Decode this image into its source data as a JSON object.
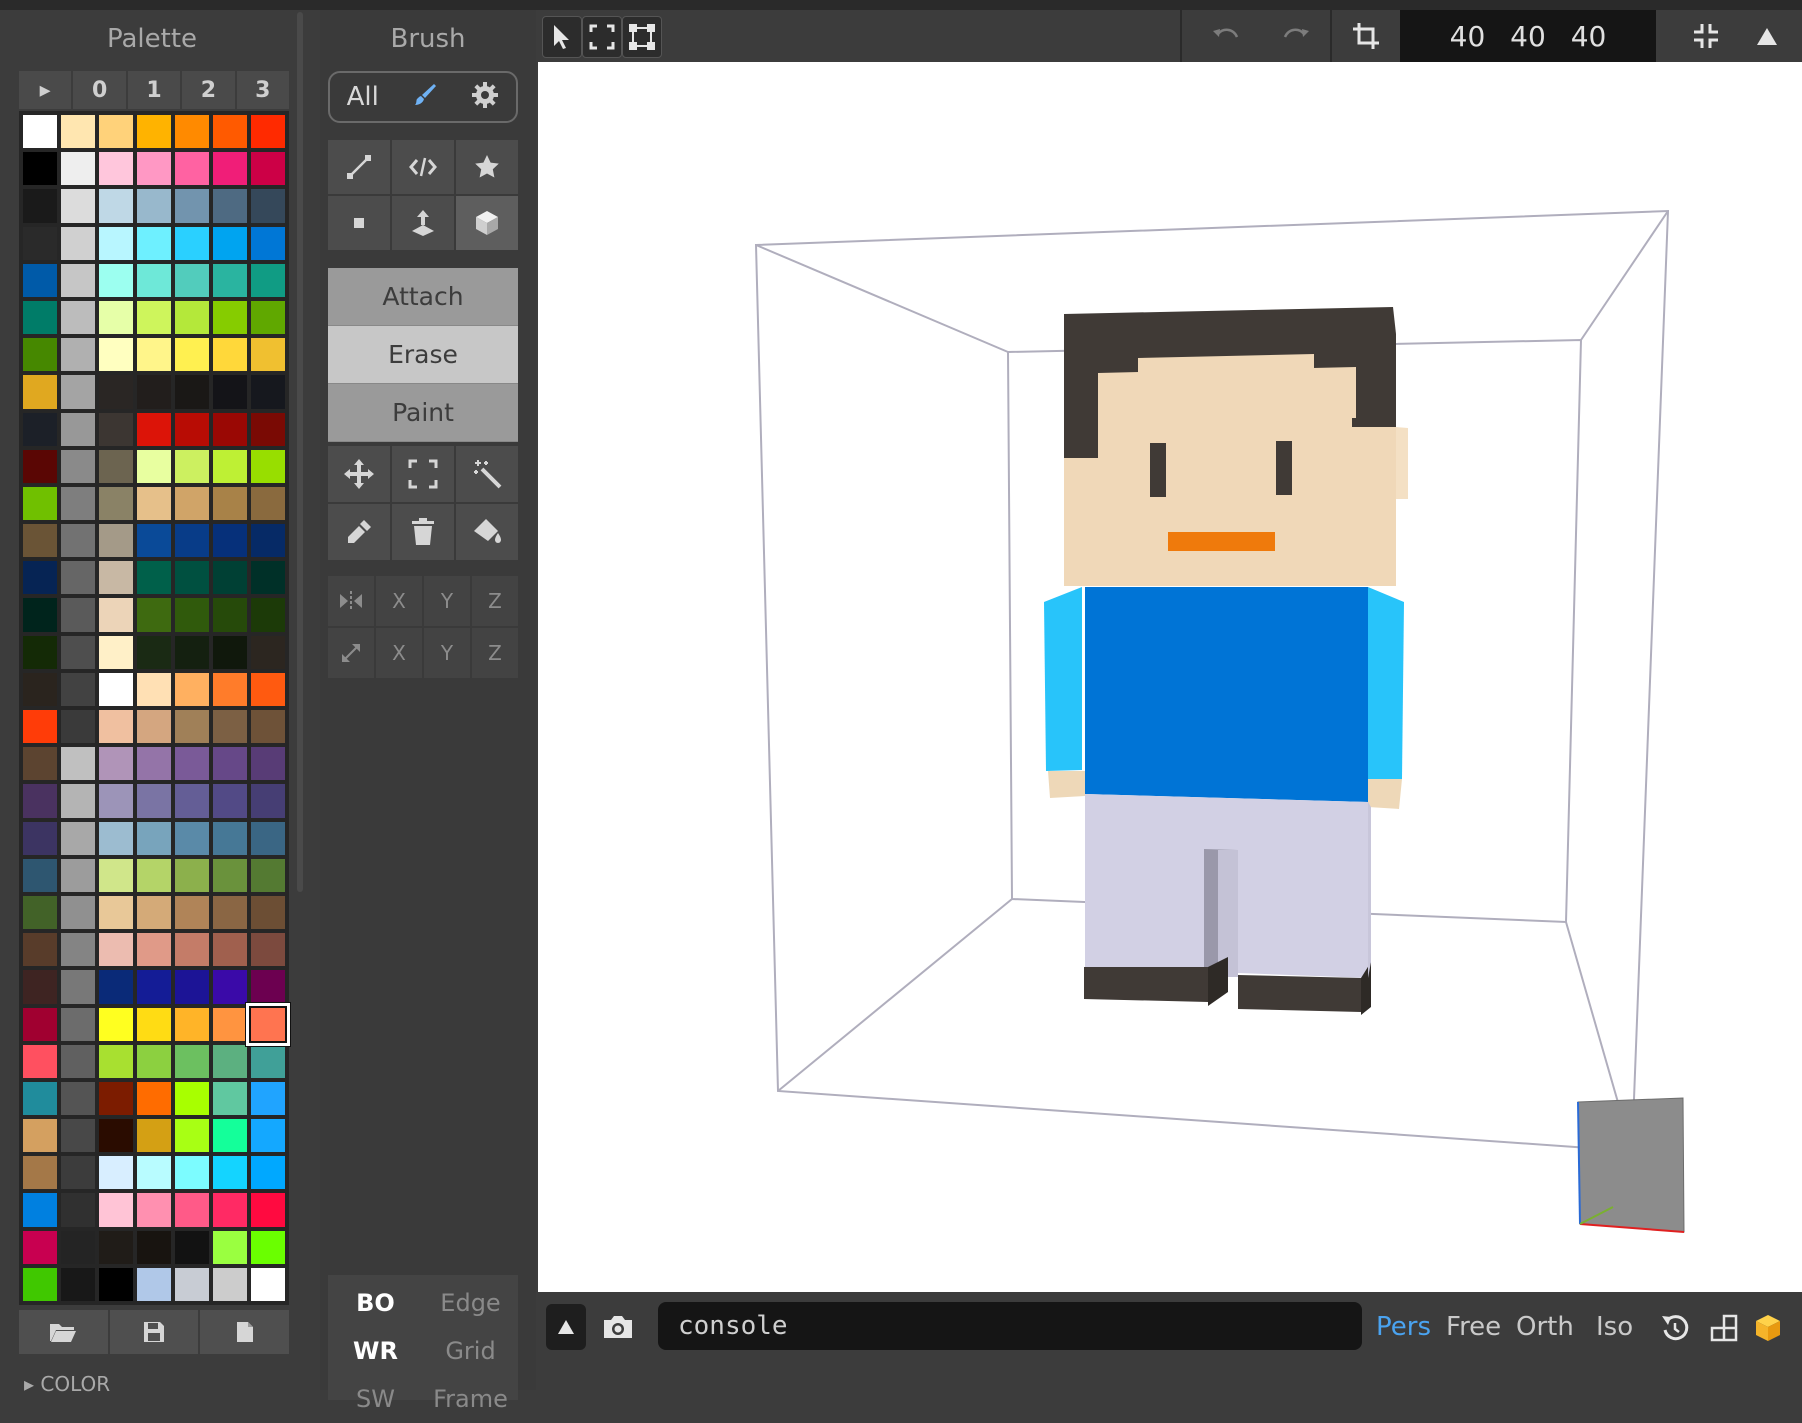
{
  "palette": {
    "title": "Palette",
    "tabs": [
      "▸",
      "0",
      "1",
      "2",
      "3"
    ],
    "color_toggle": "▸ COLOR",
    "actions": [
      "folder-open-icon",
      "save-icon",
      "new-file-icon"
    ],
    "selected_index": 174,
    "colors": [
      "#ffffff",
      "#ffe6b0",
      "#ffd27a",
      "#ffb300",
      "#ff8a00",
      "#ff5a00",
      "#ff2a00",
      "#000000",
      "#eeeeee",
      "#ffc6dc",
      "#ff98c4",
      "#ff62a2",
      "#f01e78",
      "#cc0046",
      "#1a1a1a",
      "#dcdcdc",
      "#bfd8e6",
      "#98b8cc",
      "#7294ae",
      "#4e6a82",
      "#35485a",
      "#2a2a2a",
      "#d0d0d0",
      "#b8f6ff",
      "#6ef0ff",
      "#2ad0ff",
      "#00a4f0",
      "#0077d6",
      "#005aa8",
      "#c6c6c6",
      "#9cfff0",
      "#6ee8d8",
      "#52ccbc",
      "#2ab4a0",
      "#109c84",
      "#007c68",
      "#bcbcbc",
      "#e6ffa8",
      "#cef55c",
      "#b4e83a",
      "#86cc00",
      "#60a800",
      "#468800",
      "#b0b0b0",
      "#ffffc0",
      "#fff58a",
      "#fff050",
      "#ffd83a",
      "#f0c030",
      "#e0a820",
      "#a4a4a4",
      "#2a2624",
      "#221e1c",
      "#1a1816",
      "#141418",
      "#16181e",
      "#1c2028",
      "#989898",
      "#3c3632",
      "#dc1408",
      "#b80c04",
      "#9a0804",
      "#7a0a04",
      "#5a0604",
      "#8a8a8a",
      "#6c6450",
      "#e8ffa0",
      "#ccf060",
      "#bef034",
      "#98de00",
      "#70c000",
      "#7e7e7e",
      "#8a8266",
      "#e6c08a",
      "#d0a468",
      "#a88248",
      "#8a6a3e",
      "#6a5436",
      "#727272",
      "#a49a88",
      "#0a4a98",
      "#083c88",
      "#06307a",
      "#062a66",
      "#062454",
      "#666666",
      "#c8b8a4",
      "#00604a",
      "#005040",
      "#004034",
      "#003028",
      "#00241c",
      "#5a5a5a",
      "#ecd4b8",
      "#3e6a10",
      "#305a0c",
      "#264a0a",
      "#1c3a08",
      "#142a06",
      "#4e4e4e",
      "#fff0c8",
      "#1a2a14",
      "#142010",
      "#10180c",
      "#2c2620",
      "#2a241e",
      "#424242",
      "#ffffff",
      "#ffe0b4",
      "#ffb060",
      "#ff7c2a",
      "#ff5a10",
      "#ff3c08",
      "#3a3a3a",
      "#f0c0a0",
      "#d4a680",
      "#a08058",
      "#7c6044",
      "#6e5238",
      "#5c4430",
      "#c0c0c0",
      "#b094b8",
      "#9474a8",
      "#7a5a98",
      "#664888",
      "#583c76",
      "#4a3260",
      "#b4b4b4",
      "#9c94b8",
      "#7a74a4",
      "#645e96",
      "#524a86",
      "#463e74",
      "#3c3462",
      "#a8a8a8",
      "#9cbcd0",
      "#78a4bc",
      "#5a8aa8",
      "#467896",
      "#3a6684",
      "#2e5670",
      "#9c9c9c",
      "#d0e68a",
      "#b4d468",
      "#8cb04c",
      "#6a923c",
      "#547a32",
      "#426228",
      "#909090",
      "#e8c898",
      "#d4aa78",
      "#b08458",
      "#8a6644",
      "#6c4e34",
      "#583c2a",
      "#848484",
      "#ecbcb0",
      "#e09a88",
      "#c47c68",
      "#a0604e",
      "#7c4a3e",
      "#3e2422",
      "#787878",
      "#0a2a78",
      "#141c96",
      "#1c1496",
      "#3a0aa8",
      "#6c0050",
      "#a00030",
      "#6c6c6c",
      "#ffff20",
      "#ffdc14",
      "#ffb428",
      "#ff9440",
      "#ff7450",
      "#ff5060",
      "#606060",
      "#a8e030",
      "#8cd040",
      "#6cc060",
      "#5cb080",
      "#40a098",
      "#208c9c",
      "#545454",
      "#7c1c00",
      "#ff6c00",
      "#a8ff00",
      "#60c8a0",
      "#20a4ff",
      "#d4a060",
      "#484848",
      "#2a0c00",
      "#d4a014",
      "#a8ff14",
      "#14ff9a",
      "#14a8ff",
      "#a47848",
      "#3c3c3c",
      "#d8eeff",
      "#b8fcff",
      "#7cfcff",
      "#14d4ff",
      "#00a8ff",
      "#0080e0",
      "#303030",
      "#ffc4d6",
      "#ff90b0",
      "#ff5a88",
      "#ff2a64",
      "#ff0a40",
      "#c80050",
      "#242424",
      "#201c18",
      "#181410",
      "#121212",
      "#9aff40",
      "#6aff00",
      "#40c800",
      "#181818",
      "#000000",
      "#b0c8e8",
      "#c8ccd4",
      "#cccccc",
      "#ffffff",
      "#285846"
    ]
  },
  "brush": {
    "title": "Brush",
    "filter_label": "All",
    "modes": [
      "Attach",
      "Erase",
      "Paint"
    ],
    "active_mode": "Erase",
    "axis_rows": [
      [
        "X",
        "Y",
        "Z"
      ],
      [
        "X",
        "Y",
        "Z"
      ]
    ]
  },
  "render": {
    "items": [
      {
        "label": "BO",
        "state": "on"
      },
      {
        "label": "Edge",
        "state": "off"
      },
      {
        "label": "WR",
        "state": "on"
      },
      {
        "label": "Grid",
        "state": "off"
      },
      {
        "label": "SW",
        "state": "off"
      },
      {
        "label": "Frame",
        "state": "off"
      }
    ]
  },
  "toolbar": {
    "dimensions": "40 40 40"
  },
  "console": {
    "text": "console"
  },
  "camera_modes": [
    "Pers",
    "Free",
    "Orth",
    "Iso"
  ],
  "active_camera": "Pers",
  "colors": {
    "accent": "#4aa3f0",
    "panel": "#3c3c3c",
    "skin": "#f0d8b8",
    "hair": "#403a36",
    "shirt": "#0074d6",
    "sleeve": "#28c4fa",
    "pants": "#d2d0e4",
    "mouth": "#ef7a0c"
  }
}
